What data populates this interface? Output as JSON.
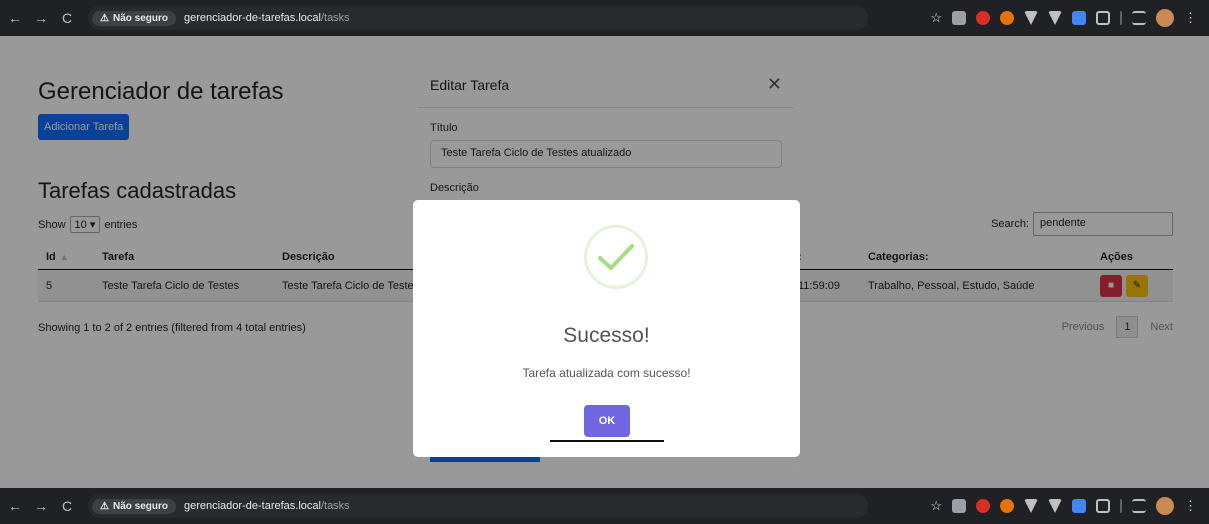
{
  "browser": {
    "back": "←",
    "forward": "→",
    "reload": "C",
    "insecure_icon": "⚠",
    "insecure_label": "Não seguro",
    "url_host": "gerenciador-de-tarefas.local",
    "url_path": "/tasks",
    "star": "☆"
  },
  "page": {
    "title": "Gerenciador de tarefas",
    "add_button": "Adicionar Tarefa",
    "section_title": "Tarefas cadastradas",
    "show_label": "Show",
    "entries_value": "10",
    "entries_label": "entries",
    "search_label": "Search:",
    "search_value": "pendente",
    "table": {
      "headers": [
        "Id",
        "Tarefa",
        "Descrição",
        ":",
        "Categorias:",
        "Ações"
      ],
      "row": {
        "id": "5",
        "tarefa": "Teste Tarefa Ciclo de Testes",
        "descricao": "Teste Tarefa Ciclo de Teste",
        "data": "11:59:09",
        "categorias": "Trabalho, Pessoal, Estudo, Saúde"
      }
    },
    "showing": "Showing 1 to 2 of 2 entries (filtered from 4 total entries)",
    "previous": "Previous",
    "page_number": "1",
    "next": "Next"
  },
  "edit_modal": {
    "title": "Editar Tarefa",
    "close": "✕",
    "titulo_label": "Título",
    "titulo_value": "Teste Tarefa Ciclo de Testes atualizado",
    "descricao_label": "Descrição"
  },
  "success_dialog": {
    "title": "Sucesso!",
    "text": "Tarefa atualizada com sucesso!",
    "ok": "OK",
    "check_color": "#a5dc86"
  }
}
